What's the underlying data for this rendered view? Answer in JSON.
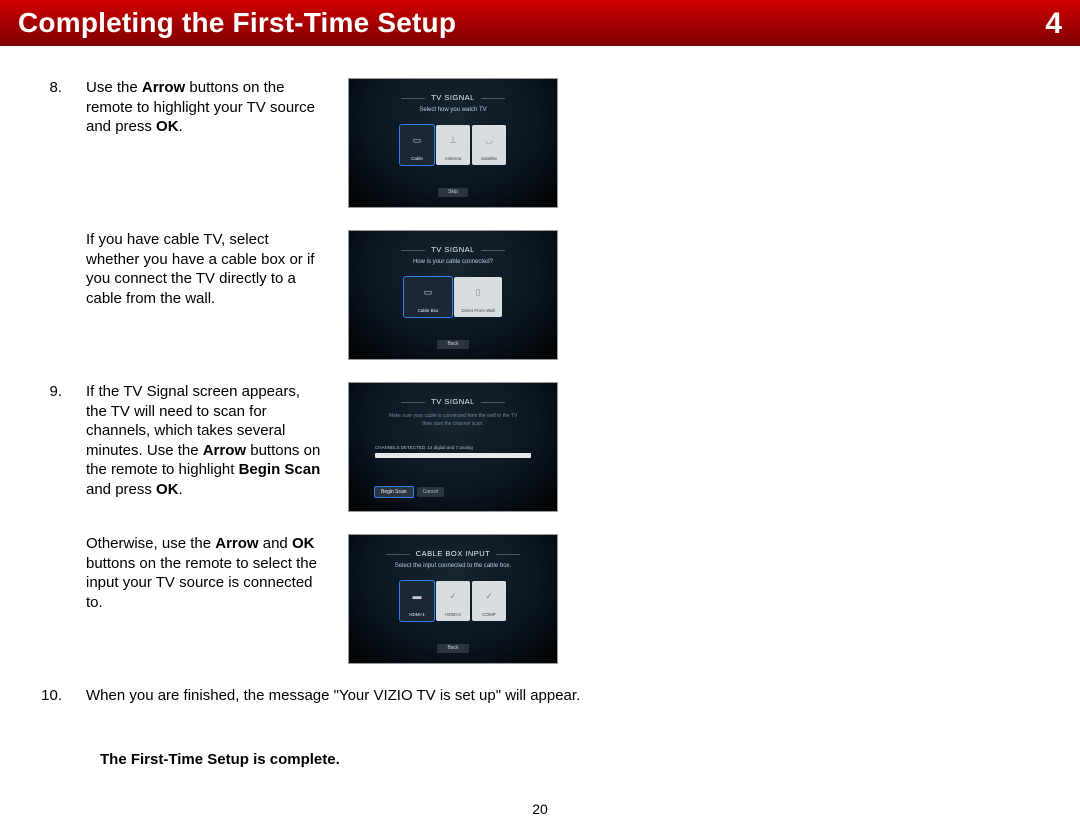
{
  "header": {
    "title": "Completing the First-Time Setup",
    "chapter": "4"
  },
  "steps": {
    "s8": {
      "num": "8.",
      "t1a": "Use the ",
      "t1b": "Arrow",
      "t1c": " buttons on the remote to highlight your TV source and press ",
      "t1d": "OK",
      "t1e": ".",
      "t2": "If you have cable TV, select whether you have a cable box or if you connect the TV directly to a cable from the wall."
    },
    "s9": {
      "num": "9.",
      "t1a": "If the TV Signal screen appears, the TV will need to scan for channels, which takes several minutes. Use the ",
      "t1b": "Arrow",
      "t1c": " buttons on the remote to highlight ",
      "t1d": "Begin Scan",
      "t1e": " and press ",
      "t1f": "OK",
      "t1g": ".",
      "t2a": "Otherwise, use the ",
      "t2b": "Arrow",
      "t2c": " and ",
      "t2d": "OK",
      "t2e": " buttons on the remote to select the input your TV source is connected to."
    },
    "s10": {
      "num": "10.",
      "t": "When you are finished, the message \"Your VIZIO TV is set up\" will appear."
    }
  },
  "screens": {
    "signal1": {
      "title": "TV SIGNAL",
      "sub": "Select how you watch TV",
      "tiles": [
        "Cable",
        "Antenna",
        "Satellite"
      ],
      "skip": "Skip"
    },
    "signal2": {
      "title": "TV SIGNAL",
      "sub": "How is your cable connected?",
      "tiles": [
        "Cable Box",
        "Direct From Wall"
      ],
      "back": "Back"
    },
    "signal3": {
      "title": "TV SIGNAL",
      "sub1": "Make sure your cable is connected from the wall to the TV",
      "sub2": "then start the channel scan.",
      "plabel": "CHANNELS DETECTED: 14 digital and 7 analog",
      "buttons": [
        "Begin Scan",
        "Cancel"
      ]
    },
    "input": {
      "title": "CABLE BOX INPUT",
      "sub": "Select the input connected to the cable box.",
      "tiles": [
        "HDMI-1",
        "HDMI-2",
        "COMP"
      ],
      "back": "Back"
    }
  },
  "final": "The First-Time Setup is complete.",
  "pagenum": "20"
}
